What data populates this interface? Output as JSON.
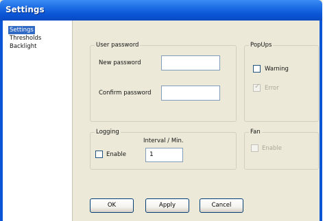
{
  "window": {
    "title": "Settings"
  },
  "sidebar": {
    "items": [
      {
        "label": "Settings",
        "selected": true
      },
      {
        "label": "Thresholds",
        "selected": false
      },
      {
        "label": "Backlight",
        "selected": false
      }
    ]
  },
  "user_password": {
    "group_label": "User password",
    "new_password_label": "New password",
    "new_password_value": "",
    "confirm_password_label": "Confirm password",
    "confirm_password_value": ""
  },
  "popups": {
    "group_label": "PopUps",
    "warning_label": "Warning",
    "warning_checked": false,
    "error_label": "Error",
    "error_checked": true,
    "error_enabled": false
  },
  "logging": {
    "group_label": "Logging",
    "enable_label": "Enable",
    "enable_checked": false,
    "interval_label": "Interval / Min.",
    "interval_value": "1"
  },
  "fan": {
    "group_label": "Fan",
    "enable_label": "Enable",
    "enable_checked": false,
    "enable_enabled": false
  },
  "buttons": {
    "ok_label": "OK",
    "apply_label": "Apply",
    "cancel_label": "Cancel"
  },
  "colors": {
    "titlebar": "#0a55d6",
    "selection": "#316ac5",
    "dialog_background": "#ece9d8"
  }
}
